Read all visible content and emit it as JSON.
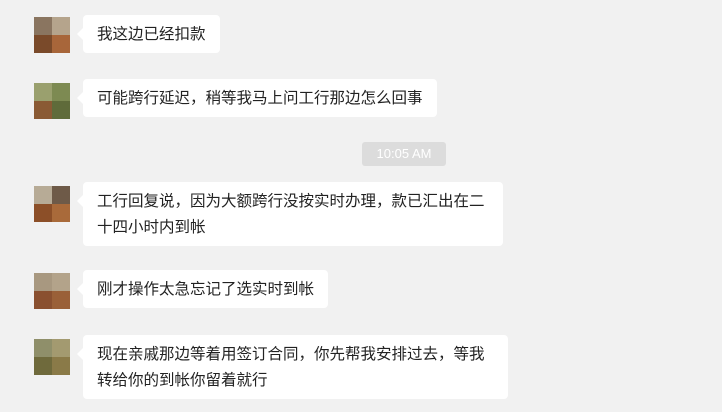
{
  "messages": [
    {
      "text": "我这边已经扣款",
      "avatar_colors": [
        "#8a7560",
        "#b5a48c",
        "#7a4a2a",
        "#a8663a"
      ]
    },
    {
      "text": "可能跨行延迟，稍等我马上问工行那边怎么回事",
      "avatar_colors": [
        "#9aa06e",
        "#7d8a52",
        "#8a5a34",
        "#5f6b3a"
      ]
    },
    {
      "text": "工行回复说，因为大额跨行没按实时办理，款已汇出在二十四小时内到帐",
      "avatar_colors": [
        "#b7ab96",
        "#6e5a48",
        "#8c4f28",
        "#a96a3a"
      ]
    },
    {
      "text": "刚才操作太急忘记了选实时到帐",
      "avatar_colors": [
        "#a89880",
        "#b3a38a",
        "#8a5030",
        "#9a6038"
      ]
    },
    {
      "text": "现在亲戚那边等着用签订合同，你先帮我安排过去，等我转给你的到帐你留着就行",
      "avatar_colors": [
        "#8f8f6a",
        "#a39a70",
        "#6f6a3c",
        "#8a7a48"
      ]
    }
  ],
  "timestamp": "10:05 AM"
}
